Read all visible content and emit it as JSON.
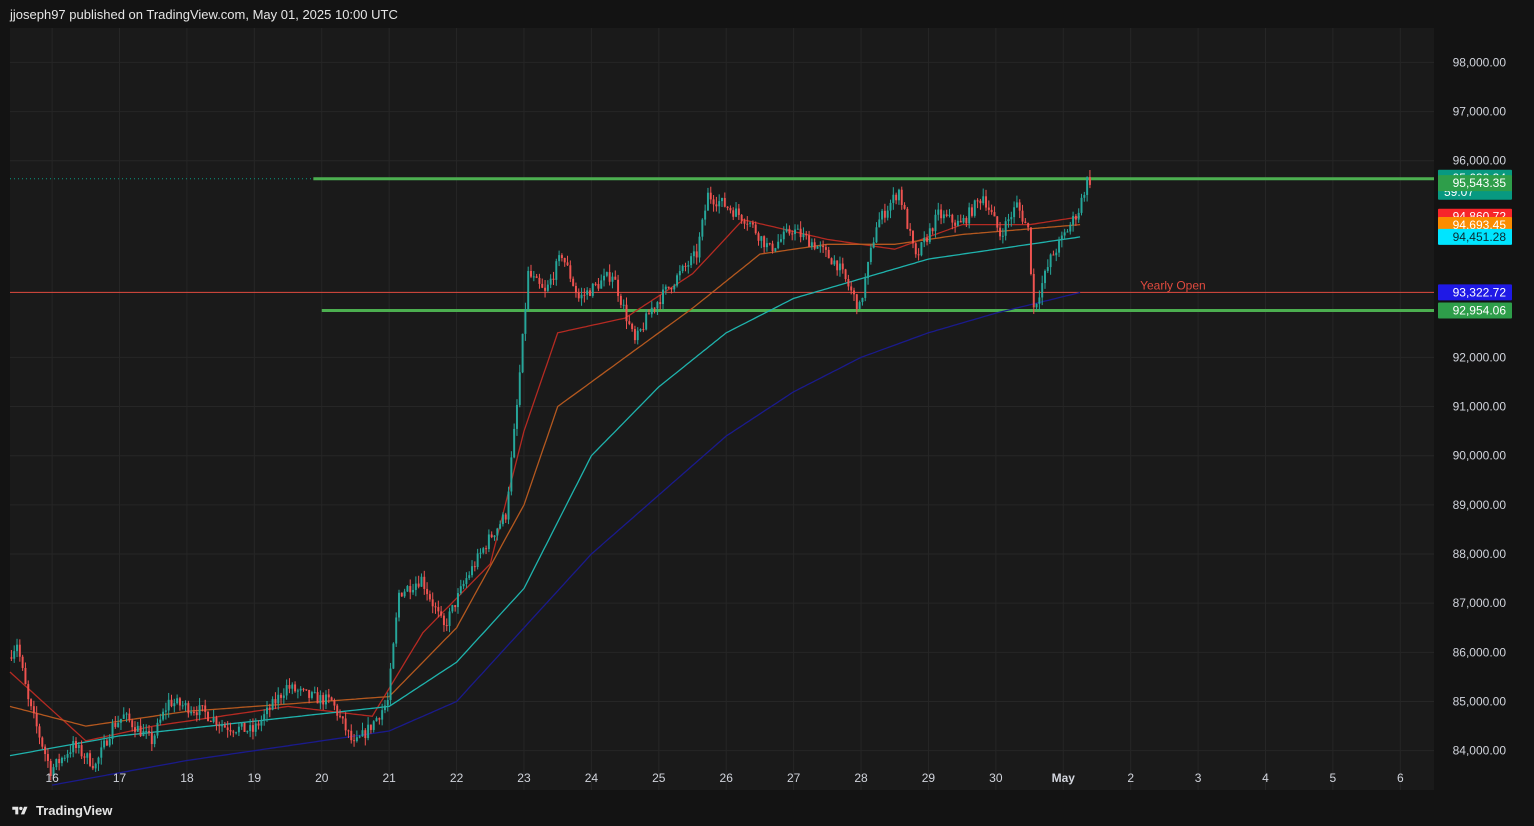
{
  "header": {
    "publisher_text": "jjoseph97 published on TradingView.com, May 01, 2025 10:00 UTC"
  },
  "footer": {
    "brand": "TradingView"
  },
  "colors": {
    "background": "#131313",
    "plot_background": "#1a1a1a",
    "grid": "#262626",
    "up_candle": "#26a69a",
    "down_candle": "#ef5350",
    "resistance_support": "#4caf50",
    "yearly_open": "#e04a3f",
    "ema_red": "#b52a22",
    "ema_orange": "#b4581f",
    "ema_cyan": "#1fb3ad",
    "ema_blue": "#1a1a8c"
  },
  "chart_data": {
    "type": "candlestick",
    "y_ticks": [
      "98,000.00",
      "97,000.00",
      "96,000.00",
      "92,000.00",
      "91,000.00",
      "90,000.00",
      "89,000.00",
      "88,000.00",
      "87,000.00",
      "86,000.00",
      "85,000.00",
      "84,000.00"
    ],
    "y_tick_values": [
      98000,
      97000,
      96000,
      92000,
      91000,
      90000,
      89000,
      88000,
      87000,
      86000,
      85000,
      84000
    ],
    "ylim": [
      83200,
      98700
    ],
    "x_ticks": [
      "16",
      "17",
      "18",
      "19",
      "20",
      "21",
      "22",
      "23",
      "24",
      "25",
      "26",
      "27",
      "28",
      "29",
      "30",
      "May",
      "2",
      "3",
      "4",
      "5",
      "6"
    ],
    "x_tick_dates": [
      "2025-04-16",
      "2025-04-17",
      "2025-04-18",
      "2025-04-19",
      "2025-04-20",
      "2025-04-21",
      "2025-04-22",
      "2025-04-23",
      "2025-04-24",
      "2025-04-25",
      "2025-04-26",
      "2025-04-27",
      "2025-04-28",
      "2025-04-29",
      "2025-04-30",
      "2025-05-01",
      "2025-05-02",
      "2025-05-03",
      "2025-05-04",
      "2025-05-05",
      "2025-05-06"
    ],
    "xlim": [
      "2025-04-15 09:00",
      "2025-05-06 12:00"
    ],
    "grid": true,
    "horizontal_lines": [
      {
        "value": 95632.34,
        "start": "2025-04-19 21:00",
        "color": "#4caf50"
      },
      {
        "value": 92954.06,
        "start": "2025-04-20 00:00",
        "color": "#4caf50"
      },
      {
        "value": 93322.72,
        "start": "2025-04-15 09:00",
        "end": "2025-05-01 06:00",
        "color": "#e04a3f",
        "label": "Yearly Open"
      }
    ],
    "last_price_dotted": 95632.34,
    "price_labels": [
      {
        "value": 95632.34,
        "text": "95,632.34",
        "sub": "59:07",
        "bg": "#089981"
      },
      {
        "value": 95543.35,
        "text": "95,543.35",
        "bg": "#2e9e4a"
      },
      {
        "value": 94860.72,
        "text": "94,860.72",
        "bg": "#f7252a"
      },
      {
        "value": 94693.45,
        "text": "94,693.45",
        "bg": "#fb8c00"
      },
      {
        "value": 94451.28,
        "text": "94,451.28",
        "bg": "#00e5ff",
        "fg": "#0b2b33"
      },
      {
        "value": 93322.72,
        "text": "93,322.72",
        "bg": "#1f19e6"
      },
      {
        "value": 92954.06,
        "text": "92,954.06",
        "bg": "#2e9e4a"
      }
    ],
    "price_anchors": [
      [
        "2025-04-15 09:00",
        85900
      ],
      [
        "2025-04-15 12:00",
        86200
      ],
      [
        "2025-04-15 16:00",
        85000
      ],
      [
        "2025-04-16 00:00",
        83600
      ],
      [
        "2025-04-16 08:00",
        84100
      ],
      [
        "2025-04-16 16:00",
        83700
      ],
      [
        "2025-04-16 22:00",
        84500
      ],
      [
        "2025-04-17 02:00",
        84700
      ],
      [
        "2025-04-17 12:00",
        84200
      ],
      [
        "2025-04-17 18:00",
        85000
      ],
      [
        "2025-04-18 06:00",
        84800
      ],
      [
        "2025-04-18 14:00",
        84500
      ],
      [
        "2025-04-19 00:00",
        84400
      ],
      [
        "2025-04-19 12:00",
        85300
      ],
      [
        "2025-04-19 20:00",
        85100
      ],
      [
        "2025-04-20 04:00",
        85000
      ],
      [
        "2025-04-20 12:00",
        84100
      ],
      [
        "2025-04-20 18:00",
        84500
      ],
      [
        "2025-04-21 00:00",
        85000
      ],
      [
        "2025-04-21 04:00",
        87200
      ],
      [
        "2025-04-21 12:00",
        87500
      ],
      [
        "2025-04-21 20:00",
        86500
      ],
      [
        "2025-04-22 04:00",
        87500
      ],
      [
        "2025-04-22 12:00",
        88300
      ],
      [
        "2025-04-22 18:00",
        88800
      ],
      [
        "2025-04-22 22:00",
        91000
      ],
      [
        "2025-04-23 02:00",
        93700
      ],
      [
        "2025-04-23 08:00",
        93300
      ],
      [
        "2025-04-23 14:00",
        94100
      ],
      [
        "2025-04-23 20:00",
        93200
      ],
      [
        "2025-04-24 08:00",
        93700
      ],
      [
        "2025-04-24 16:00",
        92300
      ],
      [
        "2025-04-24 22:00",
        93000
      ],
      [
        "2025-04-25 08:00",
        93700
      ],
      [
        "2025-04-25 14:00",
        94100
      ],
      [
        "2025-04-25 18:00",
        95300
      ],
      [
        "2025-04-26 00:00",
        95100
      ],
      [
        "2025-04-26 08:00",
        94800
      ],
      [
        "2025-04-26 16:00",
        94200
      ],
      [
        "2025-04-27 00:00",
        94600
      ],
      [
        "2025-04-27 08:00",
        94300
      ],
      [
        "2025-04-27 16:00",
        93900
      ],
      [
        "2025-04-28 00:00",
        93000
      ],
      [
        "2025-04-28 06:00",
        94700
      ],
      [
        "2025-04-28 14:00",
        95400
      ],
      [
        "2025-04-28 20:00",
        94000
      ],
      [
        "2025-04-29 04:00",
        94900
      ],
      [
        "2025-04-29 12:00",
        94700
      ],
      [
        "2025-04-29 20:00",
        95300
      ],
      [
        "2025-04-30 02:00",
        94500
      ],
      [
        "2025-04-30 08:00",
        95100
      ],
      [
        "2025-04-30 12:00",
        94600
      ],
      [
        "2025-04-30 14:00",
        93000
      ],
      [
        "2025-04-30 20:00",
        94000
      ],
      [
        "2025-05-01 02:00",
        94600
      ],
      [
        "2025-05-01 06:00",
        95000
      ],
      [
        "2025-05-01 09:00",
        95600
      ]
    ],
    "ema_anchors": {
      "red": [
        [
          "2025-04-15 09:00",
          85600
        ],
        [
          "2025-04-16 12:00",
          84200
        ],
        [
          "2025-04-17 12:00",
          84500
        ],
        [
          "2025-04-19 12:00",
          84900
        ],
        [
          "2025-04-20 18:00",
          84700
        ],
        [
          "2025-04-21 12:00",
          86400
        ],
        [
          "2025-04-22 12:00",
          87800
        ],
        [
          "2025-04-23 00:00",
          90500
        ],
        [
          "2025-04-23 12:00",
          92500
        ],
        [
          "2025-04-24 12:00",
          92800
        ],
        [
          "2025-04-25 12:00",
          93700
        ],
        [
          "2025-04-26 06:00",
          94800
        ],
        [
          "2025-04-27 12:00",
          94400
        ],
        [
          "2025-04-28 12:00",
          94200
        ],
        [
          "2025-04-29 12:00",
          94700
        ],
        [
          "2025-04-30 12:00",
          94700
        ],
        [
          "2025-05-01 06:00",
          94860
        ]
      ],
      "orange": [
        [
          "2025-04-15 09:00",
          84900
        ],
        [
          "2025-04-16 12:00",
          84500
        ],
        [
          "2025-04-18 00:00",
          84800
        ],
        [
          "2025-04-20 00:00",
          85000
        ],
        [
          "2025-04-21 00:00",
          85100
        ],
        [
          "2025-04-22 00:00",
          86500
        ],
        [
          "2025-04-23 00:00",
          89000
        ],
        [
          "2025-04-23 12:00",
          91000
        ],
        [
          "2025-04-24 12:00",
          92000
        ],
        [
          "2025-04-25 12:00",
          93000
        ],
        [
          "2025-04-26 12:00",
          94100
        ],
        [
          "2025-04-27 12:00",
          94300
        ],
        [
          "2025-04-28 12:00",
          94300
        ],
        [
          "2025-04-29 12:00",
          94500
        ],
        [
          "2025-05-01 06:00",
          94700
        ]
      ],
      "cyan": [
        [
          "2025-04-15 09:00",
          83900
        ],
        [
          "2025-04-17 00:00",
          84300
        ],
        [
          "2025-04-19 00:00",
          84600
        ],
        [
          "2025-04-21 00:00",
          84900
        ],
        [
          "2025-04-22 00:00",
          85800
        ],
        [
          "2025-04-23 00:00",
          87300
        ],
        [
          "2025-04-24 00:00",
          90000
        ],
        [
          "2025-04-25 00:00",
          91400
        ],
        [
          "2025-04-26 00:00",
          92500
        ],
        [
          "2025-04-27 00:00",
          93200
        ],
        [
          "2025-04-28 00:00",
          93600
        ],
        [
          "2025-04-29 00:00",
          94000
        ],
        [
          "2025-04-30 00:00",
          94200
        ],
        [
          "2025-05-01 06:00",
          94450
        ]
      ],
      "blue": [
        [
          "2025-04-16 00:00",
          83300
        ],
        [
          "2025-04-18 00:00",
          83800
        ],
        [
          "2025-04-20 00:00",
          84200
        ],
        [
          "2025-04-21 00:00",
          84400
        ],
        [
          "2025-04-22 00:00",
          85000
        ],
        [
          "2025-04-23 00:00",
          86500
        ],
        [
          "2025-04-24 00:00",
          88000
        ],
        [
          "2025-04-25 00:00",
          89200
        ],
        [
          "2025-04-26 00:00",
          90400
        ],
        [
          "2025-04-27 00:00",
          91300
        ],
        [
          "2025-04-28 00:00",
          92000
        ],
        [
          "2025-04-29 00:00",
          92500
        ],
        [
          "2025-04-30 00:00",
          92900
        ],
        [
          "2025-05-01 06:00",
          93320
        ]
      ]
    }
  }
}
